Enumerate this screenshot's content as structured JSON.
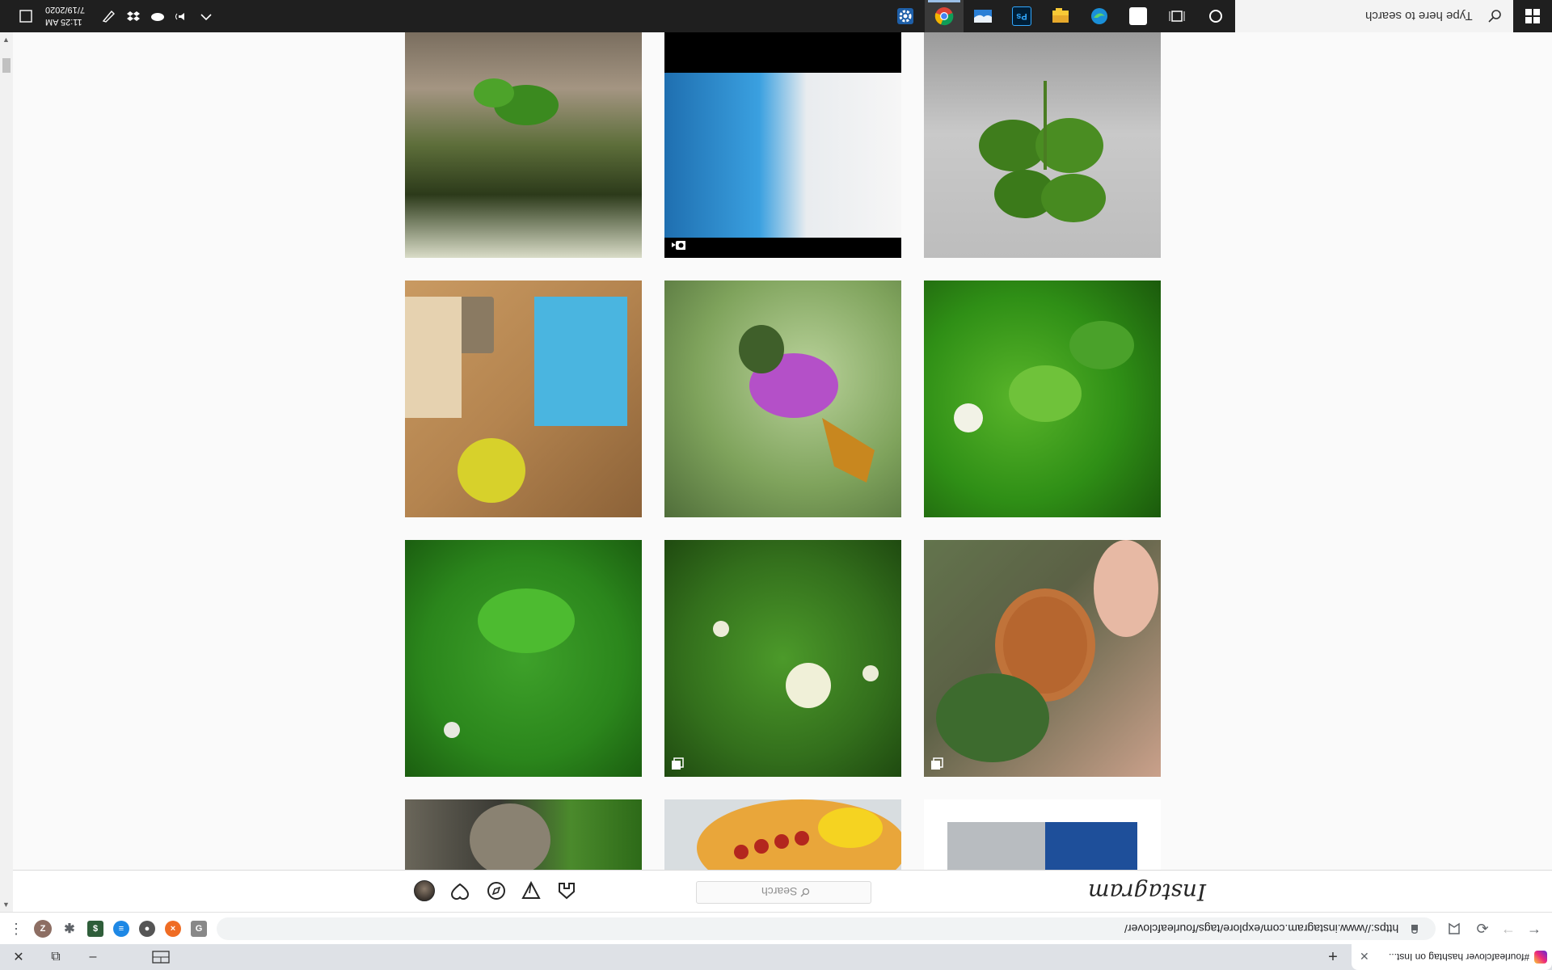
{
  "taskbar": {
    "search_placeholder": "Type here to search",
    "clock_time": "11:25 AM",
    "clock_date": "7/19/2020",
    "apps": [
      {
        "name": "Cortana",
        "icon": "circle-icon"
      },
      {
        "name": "Task View",
        "icon": "task-view-icon"
      },
      {
        "name": "Microsoft Store",
        "icon": "store-icon"
      },
      {
        "name": "Microsoft Edge",
        "icon": "edge-icon"
      },
      {
        "name": "File Explorer",
        "icon": "folder-icon"
      },
      {
        "name": "Photoshop",
        "label": "Ps",
        "icon": "photoshop-icon"
      },
      {
        "name": "OneDrive Photos",
        "icon": "photos-icon"
      },
      {
        "name": "Google Chrome",
        "icon": "chrome-icon",
        "active": true
      },
      {
        "name": "Settings",
        "icon": "gear-icon"
      }
    ]
  },
  "browser": {
    "tab_title": "#fourleafclover hashtag on Inst...",
    "url": "https://www.instagram.com/explore/tags/fourleafclover/",
    "extension_letters": [
      "Z"
    ]
  },
  "instagram": {
    "logo": "Instagram",
    "search_placeholder": "Search"
  },
  "colors": {
    "taskbar_bg": "#1f1f1f",
    "page_bg": "#fafafa",
    "accent": "#9bc0e8"
  }
}
